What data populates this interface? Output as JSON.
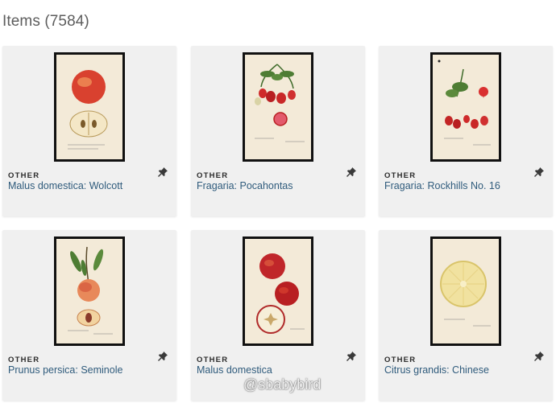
{
  "heading": "Items (7584)",
  "items": [
    {
      "type": "OTHER",
      "title": "Malus domestica: Wolcott"
    },
    {
      "type": "OTHER",
      "title": "Fragaria: Pocahontas"
    },
    {
      "type": "OTHER",
      "title": "Fragaria: Rockhills No. 16"
    },
    {
      "type": "OTHER",
      "title": "Prunus persica: Seminole"
    },
    {
      "type": "OTHER",
      "title": "Malus domestica"
    },
    {
      "type": "OTHER",
      "title": "Citrus grandis: Chinese"
    }
  ],
  "watermark": "@sbabybird",
  "icons": {
    "pin": "pushpin-icon"
  },
  "colors": {
    "title_link": "#2f5b7c",
    "card_bg": "#f0f0f0"
  }
}
